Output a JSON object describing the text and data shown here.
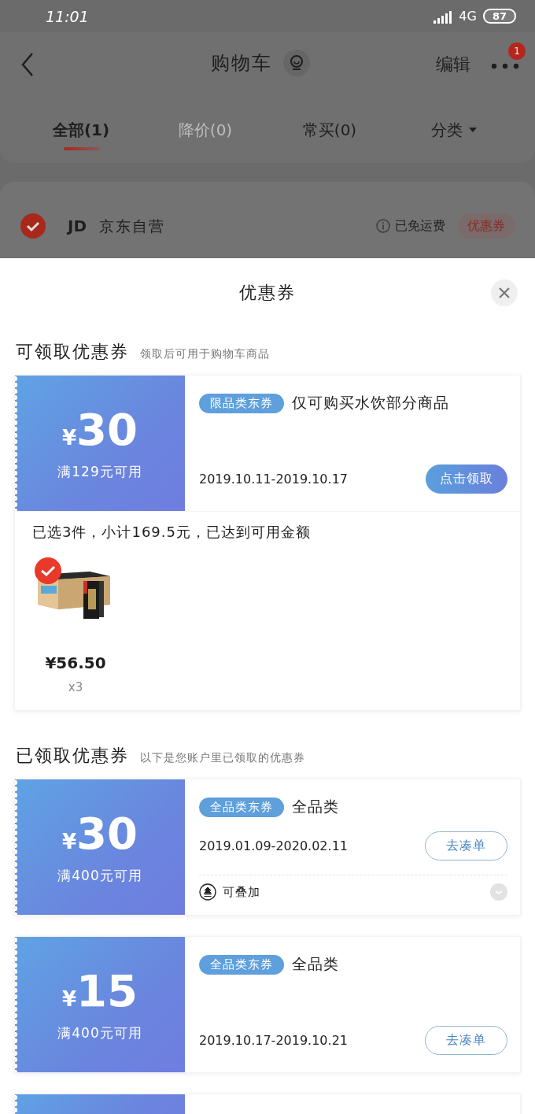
{
  "status_bar": {
    "time": "11:01",
    "network": "4G",
    "battery": "87"
  },
  "nav": {
    "title": "购物车",
    "edit": "编辑",
    "badge": "1"
  },
  "tabs": [
    {
      "label": "全部(1)",
      "selected": true,
      "disabled": false,
      "kind": "tab"
    },
    {
      "label": "降价(0)",
      "selected": false,
      "disabled": true,
      "kind": "tab"
    },
    {
      "label": "常买(0)",
      "selected": false,
      "disabled": false,
      "kind": "tab"
    },
    {
      "label": "分类",
      "selected": false,
      "disabled": false,
      "kind": "dropdown"
    }
  ],
  "store": {
    "checked": true,
    "logo": "JD",
    "name": "京东自营",
    "shipping": "已免运费",
    "coupon_tag": "优惠券"
  },
  "sheet": {
    "title": "优惠券",
    "sections": [
      {
        "title": "可领取优惠券",
        "subtitle": "领取后可用于购物车商品",
        "coupons": [
          {
            "currency": "¥",
            "amount": "30",
            "condition": "满129元可用",
            "tag": "限品类东券",
            "scope": "仅可购买水饮部分商品",
            "dates": "2019.10.11-2019.10.17",
            "button": {
              "label": "点击领取",
              "kind": "filled"
            },
            "detail": {
              "summary": "已选3件，小计169.5元，已达到可用金额",
              "products": [
                {
                  "checked": true,
                  "price": "¥56.50",
                  "qty": "x3",
                  "kind": "picture"
                }
              ]
            }
          }
        ]
      },
      {
        "title": "已领取优惠券",
        "subtitle": "以下是您账户里已领取的优惠券",
        "coupons": [
          {
            "currency": "¥",
            "amount": "30",
            "condition": "满400元可用",
            "tag": "全品类东券",
            "scope": "全品类",
            "dates": "2019.01.09-2020.02.11",
            "button": {
              "label": "去凑单",
              "kind": "outline"
            },
            "stackable": "可叠加"
          },
          {
            "currency": "¥",
            "amount": "15",
            "condition": "满400元可用",
            "tag": "全品类东券",
            "scope": "全品类",
            "dates": "2019.10.17-2019.10.21",
            "button": {
              "label": "去凑单",
              "kind": "outline"
            }
          }
        ]
      }
    ]
  }
}
